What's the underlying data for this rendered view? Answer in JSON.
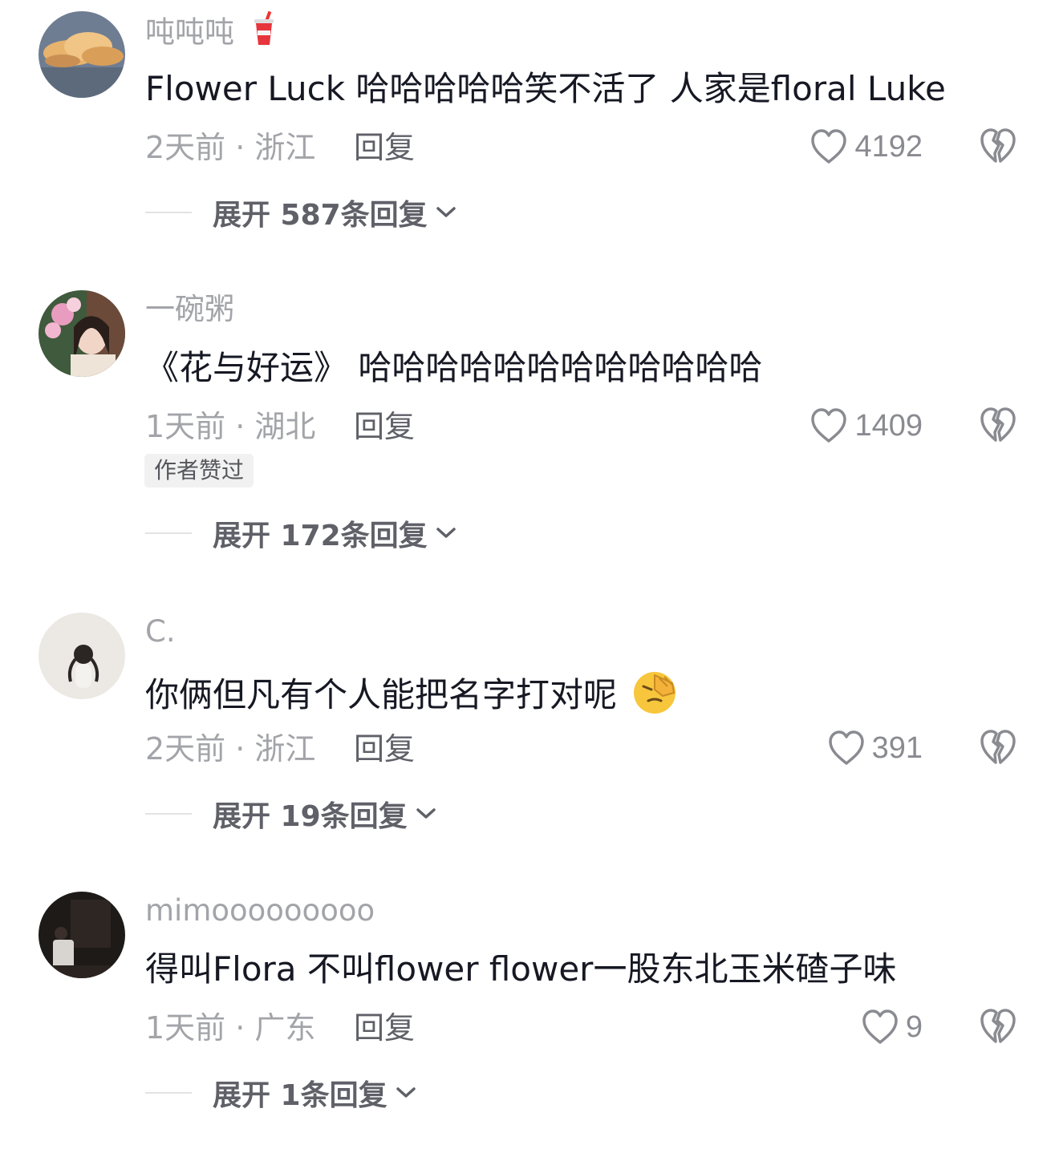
{
  "comments": [
    {
      "username": "吨吨吨",
      "text": "Flower  Luck  哈哈哈哈哈笑不活了   人家是floral  Luke",
      "meta": "2天前 · 浙江",
      "reply_label": "回复",
      "likes": "4192",
      "expand_label": "展开 587条回复"
    },
    {
      "username": "一碗粥",
      "text": "《花与好运》  哈哈哈哈哈哈哈哈哈哈哈哈",
      "meta": "1天前 · 湖北",
      "reply_label": "回复",
      "likes": "1409",
      "badge": "作者赞过",
      "expand_label": "展开 172条回复"
    },
    {
      "username": "C.",
      "text": "你俩但凡有个人能把名字打对呢",
      "meta": "2天前 · 浙江",
      "reply_label": "回复",
      "likes": "391",
      "expand_label": "展开 19条回复"
    },
    {
      "username": "mimooooooooo",
      "text": "得叫Flora 不叫flower flower一股东北玉米碴子味",
      "meta": "1天前 · 广东",
      "reply_label": "回复",
      "likes": "9",
      "expand_label": "展开 1条回复"
    }
  ],
  "icons": {
    "like": "heart-outline-icon",
    "dislike": "broken-heart-icon",
    "expand": "chevron-down-icon",
    "cup": "drink-cup-emoji",
    "facepalm": "facepalm-emoji"
  }
}
